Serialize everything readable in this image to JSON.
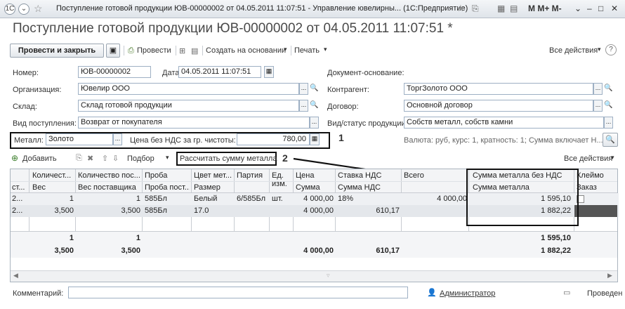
{
  "window": {
    "title": "Поступление готовой продукции ЮВ-00000002 от 04.05.2011 11:07:51 - Управление ювелирны... (1С:Предприятие)",
    "memory_buttons": "M  M+ M-"
  },
  "doc_title": "Поступление готовой продукции ЮВ-00000002 от 04.05.2011 11:07:51 *",
  "toolbar": {
    "post_close": "Провести и закрыть",
    "post": "Провести",
    "create_based": "Создать на основании",
    "print": "Печать",
    "all_actions": "Все действия"
  },
  "form": {
    "number_label": "Номер:",
    "number": "ЮВ-00000002",
    "date_label": "Дата:",
    "date": "04.05.2011 11:07:51",
    "doc_base_label": "Документ-основание:",
    "org_label": "Организация:",
    "org": "Ювелир ООО",
    "contr_label": "Контрагент:",
    "contr": "ТоргЗолото ООО",
    "wh_label": "Склад:",
    "wh": "Склад готовой продукции",
    "contract_label": "Договор:",
    "contract": "Основной договор",
    "kind_label": "Вид поступления:",
    "kind": "Возврат от покупателя",
    "status_label": "Вид/статус продукции:",
    "status": "Собств металл, собств камни",
    "metal_label": "Металл:",
    "metal": "Золото",
    "price_label": "Цена без НДС за гр. чистоты:",
    "price": "780,00",
    "currency_info": "Валюта: руб, курс: 1, кратность: 1; Сумма включает Н..."
  },
  "marker1": "1",
  "marker2": "2",
  "table_toolbar": {
    "add": "Добавить",
    "select": "Подбор",
    "calc_metal": "Рассчитать сумму металла",
    "all_actions": "Все действия"
  },
  "columns_top": [
    "Количест...",
    "Количество пос...",
    "Проба",
    "Цвет мет...",
    "Партия",
    "Ед.",
    "Цена",
    "Ставка НДС",
    "Всего",
    "Сумма металла без НДС",
    "Клеймо"
  ],
  "columns_bottom": [
    "Вес",
    "Вес поставщика",
    "Проба пост...",
    "Размер",
    "",
    "изм.",
    "Сумма",
    "Сумма НДС",
    "",
    "Сумма металла",
    "Заказ"
  ],
  "rows": [
    {
      "n": "2...",
      "c0": "1",
      "c1": "1",
      "c2": "585Бл",
      "c3": "Белый",
      "c4": "6/585Бл",
      "c5": "шт.",
      "c6": "4 000,00",
      "c7": "18%",
      "c8": "4 000,00",
      "c9": "1 595,10"
    },
    {
      "n": "2...",
      "c0": "3,500",
      "c1": "3,500",
      "c2": "585Бл",
      "c3": "17.0",
      "c4": "",
      "c5": "",
      "c6": "4 000,00",
      "c7": "610,17",
      "c8": "",
      "c9": "1 882,22"
    }
  ],
  "totals": {
    "t1_c0": "1",
    "t1_c1": "1",
    "t1_c9": "1 595,10",
    "t2_c0": "3,500",
    "t2_c1": "3,500",
    "t2_c6": "4 000,00",
    "t2_c7": "610,17",
    "t2_c9": "1 882,22"
  },
  "footer": {
    "comment_label": "Комментарий:",
    "user": "Администратор",
    "status": "Проведен"
  }
}
